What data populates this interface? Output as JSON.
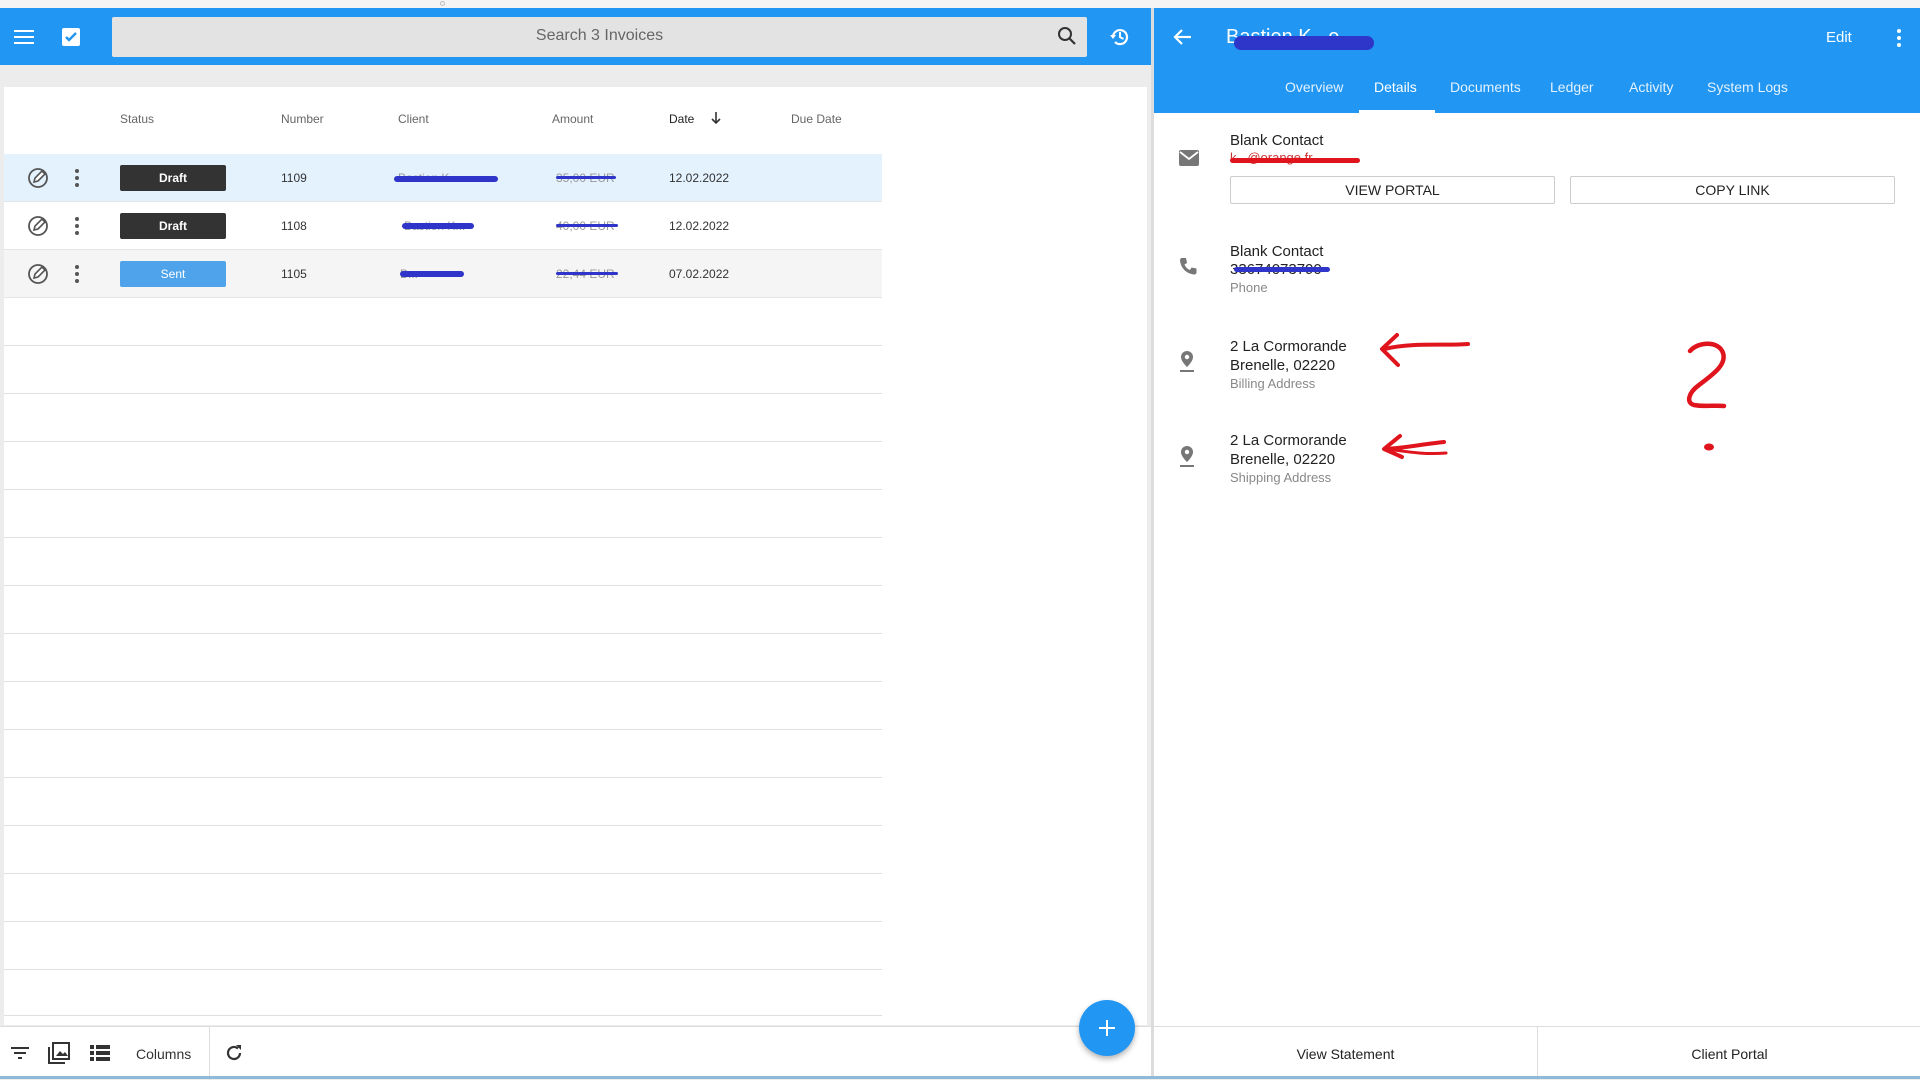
{
  "colors": {
    "primary": "#2196f3",
    "draft": "#333333",
    "sent": "#4ea3ea",
    "annotation_red": "#e0141c",
    "redaction_blue": "#2e36c9"
  },
  "left": {
    "search": {
      "placeholder": "Search 3 Invoices"
    },
    "columns": {
      "status": "Status",
      "number": "Number",
      "client": "Client",
      "amount": "Amount",
      "date": "Date",
      "due_date": "Due Date"
    },
    "rows": [
      {
        "status": "Draft",
        "number": "1109",
        "client": "Bastien K...",
        "amount": "35,00 EUR",
        "date": "12.02.2022"
      },
      {
        "status": "Draft",
        "number": "1108",
        "client": "Bastien K...",
        "amount": "40,00 EUR",
        "date": "12.02.2022"
      },
      {
        "status": "Sent",
        "number": "1105",
        "client": "B...",
        "amount": "22,44 EUR",
        "date": "07.02.2022"
      }
    ],
    "bottom": {
      "columns_label": "Columns"
    }
  },
  "right": {
    "title": "Bastien K...e",
    "edit_label": "Edit",
    "tabs": [
      "Overview",
      "Details",
      "Documents",
      "Ledger",
      "Activity",
      "System Logs"
    ],
    "email_contact": {
      "name": "Blank Contact",
      "value": "k...@orange.fr",
      "view_portal": "VIEW PORTAL",
      "copy_link": "COPY LINK"
    },
    "phone_contact": {
      "name": "Blank Contact",
      "value": "33674073790",
      "hint": "Phone"
    },
    "billing": {
      "line1": "2 La Cormorande",
      "line2": "Brenelle, 02220",
      "hint": "Billing Address"
    },
    "shipping": {
      "line1": "2 La Cormorande",
      "line2": "Brenelle, 02220",
      "hint": "Shipping Address"
    },
    "bottom": {
      "view_statement": "View Statement",
      "client_portal": "Client Portal"
    }
  }
}
